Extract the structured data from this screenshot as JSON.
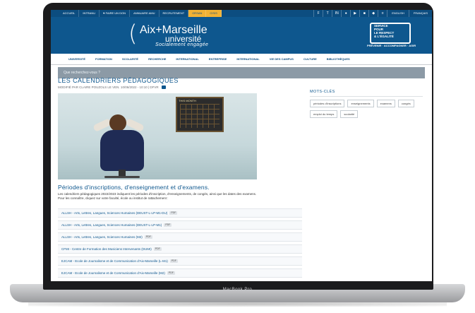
{
  "topbar": {
    "links": [
      "ACCUEIL",
      "INTRANU",
      "♥ FAIRE UN DON",
      "ANNUAIRE AMU",
      "RECRUTEMENT",
      "ORSAN",
      "CISIS"
    ],
    "lang": [
      "ENGLISH",
      "FRANÇAIS"
    ]
  },
  "logo": {
    "line1": "Aix+Marseille",
    "line2": "université",
    "line3": "Socialement engagée"
  },
  "service": {
    "lines": [
      "SERVICE",
      "POUR",
      "LE RESPECT",
      "& L'ÉGALITÉ"
    ],
    "tagline": "PRÉVENIR · ACCOMPAGNER · AGIR"
  },
  "nav": [
    "UNIVERSITÉ",
    "FORMATION",
    "SCOLARITÉ",
    "RECHERCHE",
    "INTERNATIONAL",
    "ENTREPRISE",
    "INTERNATIONAL",
    "VIE DES CAMPUS",
    "CULTURE",
    "BIBLIOTHÈQUES"
  ],
  "search": {
    "placeholder": "Que recherchez-vous ?"
  },
  "page": {
    "title": "LES CALENDRIERS PÉDAGOGIQUES",
    "meta": "MODIFIÉ PAR CLAIRE POUZOLS LE VEN. 10/06/2022 - 10:10 | DFVR"
  },
  "hero": {
    "calendar_label": "THIS MONTH"
  },
  "sidebar": {
    "title": "MOTS-CLÉS",
    "tags": [
      "périodes d'inscriptions",
      "enseignements",
      "examens",
      "congés",
      "emploi du temps",
      "scolarité"
    ]
  },
  "section": {
    "title": "Périodes d'inscriptions, d'enseignement et d'examens.",
    "intro": "Les calendriers pédagogiques 2022/2023 indiquent les périodes d'inscription, d'enseignements, de congés, ainsi que les dates des examens.",
    "intro2": "Pour les connaître, cliquez sur votre faculté, école ou institut de rattachement :"
  },
  "links": [
    "ALLSH - Arts, Lettres, Langues, Sciences Humaines (DEUST-L-LP-M1-DU)",
    "ALLSH - Arts, Lettres, Langues, Sciences Humaines (DEUST-L-LP-M1)",
    "ALLSH - Arts, Lettres, Langues, Sciences Humaines (M2)",
    "CFMI - Centre de Formation des Musiciens Intervenants (DUMI)",
    "EJCAM - Ecole de Journalisme et de Communication d'Aix-Marseille (L-M1)",
    "EJCAM - Ecole de Journalisme et de Communication d'Aix-Marseille (M2)"
  ],
  "pdf_label": "PDF",
  "device": {
    "label": "MacBook Pro"
  }
}
